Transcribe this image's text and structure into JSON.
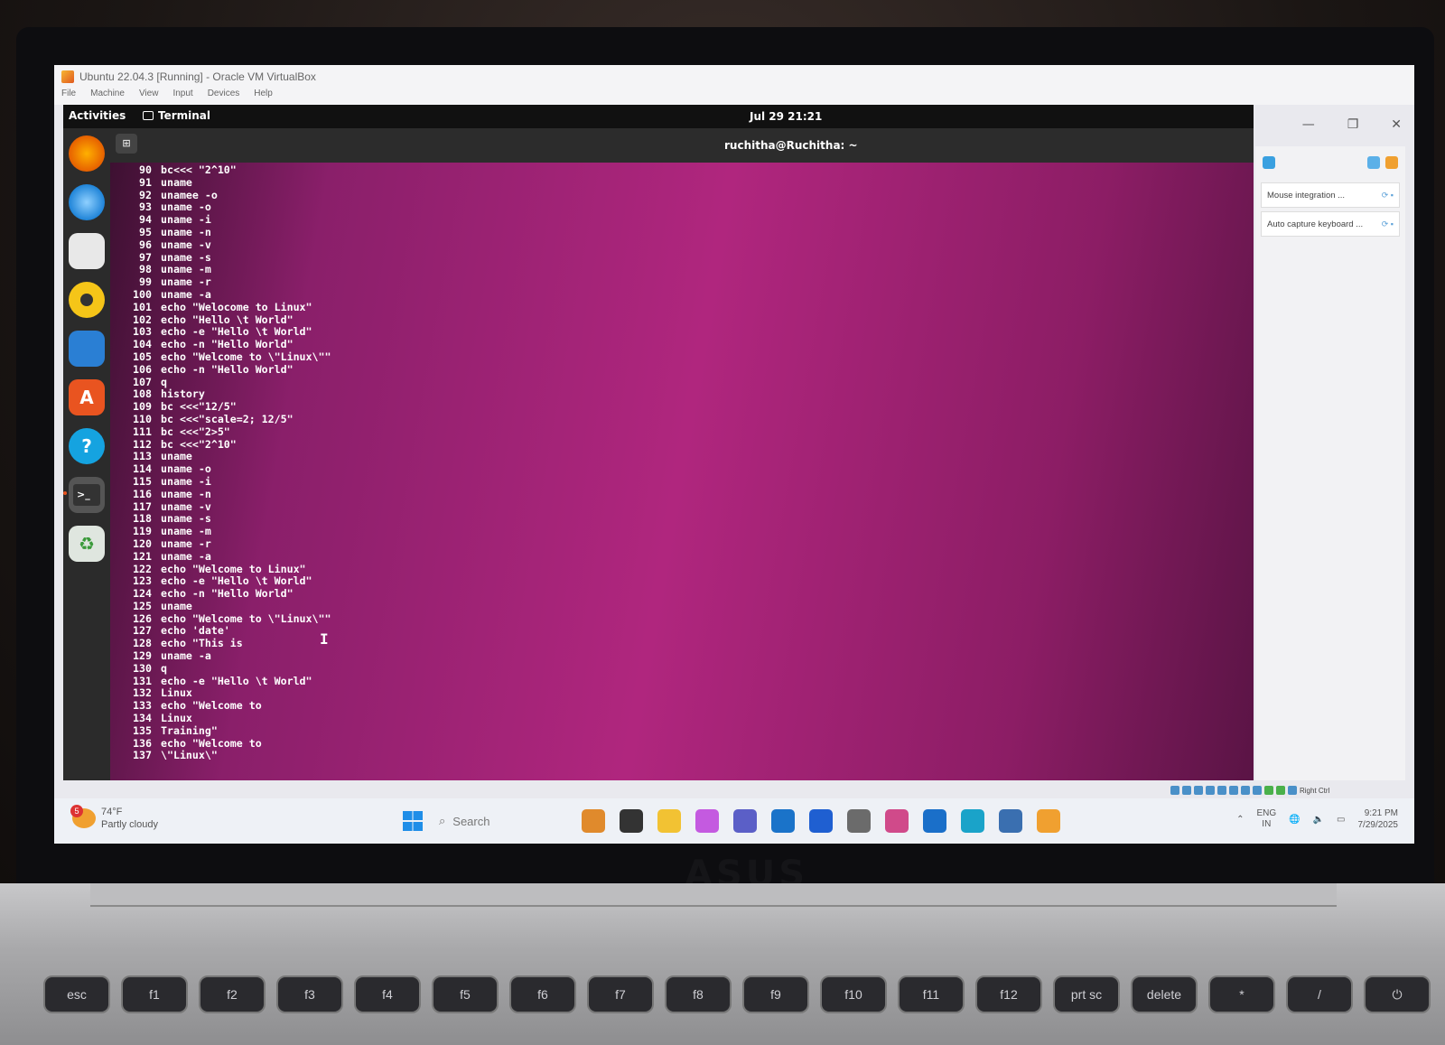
{
  "vbox": {
    "title": "Ubuntu 22.04.3 [Running] - Oracle VM VirtualBox",
    "menu": [
      "File",
      "Machine",
      "View",
      "Input",
      "Devices",
      "Help"
    ],
    "notices": [
      {
        "label": "Mouse integration ..."
      },
      {
        "label": "Auto capture keyboard ..."
      }
    ],
    "host_key": "Right Ctrl"
  },
  "ubuntu": {
    "activities": "Activities",
    "app_name": "Terminal",
    "clock": "Jul 29  21:21",
    "dock": [
      {
        "name": "firefox-icon",
        "color": "#e66000"
      },
      {
        "name": "thunderbird-icon",
        "color": "#1f84d8"
      },
      {
        "name": "files-icon",
        "color": "#e8e8e8"
      },
      {
        "name": "rhythmbox-icon",
        "color": "#f5c518"
      },
      {
        "name": "writer-icon",
        "color": "#2a7fd4"
      },
      {
        "name": "software-icon",
        "color": "#e95420"
      },
      {
        "name": "help-icon",
        "color": "#15a3e0"
      },
      {
        "name": "terminal-icon",
        "color": "#333333"
      },
      {
        "name": "trash-icon",
        "color": "#dfe6df"
      }
    ]
  },
  "terminal": {
    "title": "ruchitha@Ruchitha: ~",
    "lines": [
      {
        "n": "90",
        "cmd": "bc<<< \"2^10\""
      },
      {
        "n": "91",
        "cmd": "uname"
      },
      {
        "n": "92",
        "cmd": "unamee -o"
      },
      {
        "n": "93",
        "cmd": "uname -o"
      },
      {
        "n": "94",
        "cmd": "uname -i"
      },
      {
        "n": "95",
        "cmd": "uname -n"
      },
      {
        "n": "96",
        "cmd": "uname -v"
      },
      {
        "n": "97",
        "cmd": "uname -s"
      },
      {
        "n": "98",
        "cmd": "uname -m"
      },
      {
        "n": "99",
        "cmd": "uname -r"
      },
      {
        "n": "100",
        "cmd": "uname -a"
      },
      {
        "n": "101",
        "cmd": "echo \"Welocome to Linux\""
      },
      {
        "n": "102",
        "cmd": "echo \"Hello \\t World\""
      },
      {
        "n": "103",
        "cmd": "echo -e \"Hello \\t World\""
      },
      {
        "n": "104",
        "cmd": "echo -n \"Hello World\""
      },
      {
        "n": "105",
        "cmd": "echo \"Welcome to \\\"Linux\\\"\""
      },
      {
        "n": "106",
        "cmd": "echo -n \"Hello World\""
      },
      {
        "n": "107",
        "cmd": "q"
      },
      {
        "n": "108",
        "cmd": "history"
      },
      {
        "n": "109",
        "cmd": "bc <<<\"12/5\""
      },
      {
        "n": "110",
        "cmd": "bc <<<\"scale=2; 12/5\""
      },
      {
        "n": "111",
        "cmd": "bc <<<\"2>5\""
      },
      {
        "n": "112",
        "cmd": "bc <<<\"2^10\""
      },
      {
        "n": "113",
        "cmd": "uname"
      },
      {
        "n": "114",
        "cmd": "uname -o"
      },
      {
        "n": "115",
        "cmd": "uname -i"
      },
      {
        "n": "116",
        "cmd": "uname -n"
      },
      {
        "n": "117",
        "cmd": "uname -v"
      },
      {
        "n": "118",
        "cmd": "uname -s"
      },
      {
        "n": "119",
        "cmd": "uname -m"
      },
      {
        "n": "120",
        "cmd": "uname -r"
      },
      {
        "n": "121",
        "cmd": "uname -a"
      },
      {
        "n": "122",
        "cmd": "echo \"Welcome to Linux\""
      },
      {
        "n": "123",
        "cmd": "echo -e \"Hello \\t World\""
      },
      {
        "n": "124",
        "cmd": "echo -n \"Hello World\""
      },
      {
        "n": "125",
        "cmd": "uname"
      },
      {
        "n": "126",
        "cmd": "echo \"Welcome to \\\"Linux\\\"\""
      },
      {
        "n": "127",
        "cmd": "echo 'date'"
      },
      {
        "n": "128",
        "cmd": "echo \"This is"
      },
      {
        "n": "129",
        "cmd": "uname -a"
      },
      {
        "n": "130",
        "cmd": "q"
      },
      {
        "n": "131",
        "cmd": "echo -e \"Hello \\t World\""
      },
      {
        "n": "132",
        "cmd": "Linux"
      },
      {
        "n": "133",
        "cmd": "echo \"Welcome to"
      },
      {
        "n": "134",
        "cmd": "Linux"
      },
      {
        "n": "135",
        "cmd": "Training\""
      },
      {
        "n": "136",
        "cmd": "echo \"Welcome to"
      },
      {
        "n": "137",
        "cmd": "\\\"Linux\\\""
      }
    ]
  },
  "taskbar": {
    "weather_temp": "74°F",
    "weather_desc": "Partly cloudy",
    "weather_badge": "5",
    "search_placeholder": "Search",
    "apps": [
      {
        "name": "tiger-app-icon",
        "color": "#e08a2c"
      },
      {
        "name": "task-view-icon",
        "color": "#333333"
      },
      {
        "name": "file-explorer-icon",
        "color": "#f2c233"
      },
      {
        "name": "copilot-icon",
        "color": "#c45ae0"
      },
      {
        "name": "teams-icon",
        "color": "#5b5fc7"
      },
      {
        "name": "mail-icon",
        "color": "#1a73c9"
      },
      {
        "name": "app-blue-icon",
        "color": "#1f5fd1"
      },
      {
        "name": "whatsapp-icon",
        "color": "#6b6b6b"
      },
      {
        "name": "store-colored-icon",
        "color": "#d04a8a"
      },
      {
        "name": "store-icon",
        "color": "#1a6fc9"
      },
      {
        "name": "edge-icon",
        "color": "#1aa3c9"
      },
      {
        "name": "virtualbox-manager-icon",
        "color": "#3a6fb0"
      },
      {
        "name": "virtualbox-vm-icon",
        "color": "#f0a030"
      }
    ],
    "lang_top": "ENG",
    "lang_bottom": "IN",
    "time": "9:21 PM",
    "date": "7/29/2025"
  },
  "keyboard": {
    "brand": "ASUS",
    "keys": [
      "esc",
      "f1",
      "f2",
      "f3",
      "f4",
      "f5",
      "f6",
      "f7",
      "f8",
      "f9",
      "f10",
      "f11",
      "f12",
      "prt sc",
      "delete",
      "*",
      "/",
      "⏻"
    ]
  }
}
